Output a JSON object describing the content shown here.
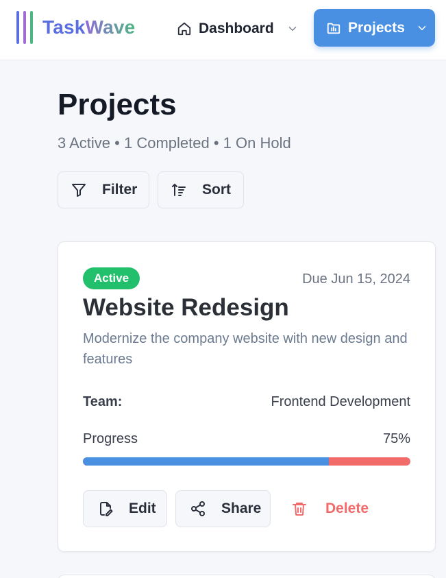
{
  "app": {
    "name_part1": "Task",
    "name_part2": "Wave",
    "logo_colors": [
      "#5b6ee1",
      "#a06cd5",
      "#4cb782"
    ],
    "name_color1": "#5b6ee1",
    "name_color2_start": "#8e6cd8",
    "name_color2_end": "#4cb782"
  },
  "nav": {
    "dashboard_label": "Dashboard",
    "projects_label": "Projects",
    "active_color": "#4a90e2"
  },
  "page": {
    "title": "Projects",
    "summary": "3 Active • 1 Completed • 1 On Hold"
  },
  "toolbar": {
    "filter_label": "Filter",
    "sort_label": "Sort"
  },
  "project": {
    "status": "Active",
    "status_color": "#22c06c",
    "due": "Due Jun 15, 2024",
    "title": "Website Redesign",
    "description": "Modernize the company website with new design and features",
    "team_label": "Team:",
    "team_value": "Frontend Development",
    "progress_label": "Progress",
    "progress_text": "75%",
    "progress_value": 0.75,
    "progress_color": "#4a90e2",
    "progress_remaining_color": "#f26b6b",
    "actions": {
      "edit_label": "Edit",
      "share_label": "Share",
      "delete_label": "Delete",
      "delete_color": "#f26b6b"
    }
  }
}
